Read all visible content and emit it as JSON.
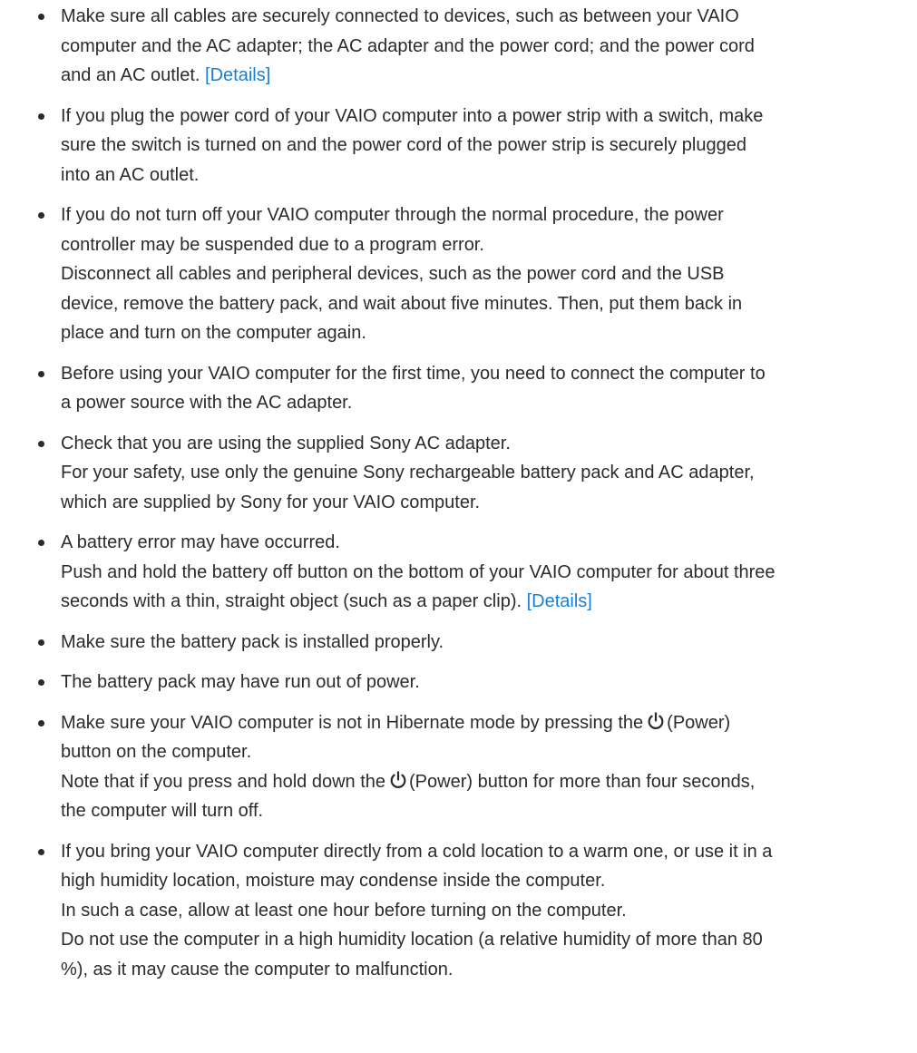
{
  "tips": [
    {
      "lines": [
        "Make sure all cables are securely connected to devices, such as between your VAIO",
        "computer and the AC adapter; the AC adapter and the power cord; and the power cord",
        "and an AC outlet."
      ],
      "link": "[Details]"
    },
    {
      "lines": [
        "If you plug the power cord of your VAIO computer into a power strip with a switch, make",
        "sure the switch is turned on and the power cord of the power strip is securely plugged",
        "into an AC outlet."
      ]
    },
    {
      "lines": [
        "If you do not turn off your VAIO computer through the normal procedure, the power",
        "controller may be suspended due to a program error.",
        "Disconnect all cables and peripheral devices, such as the power cord and the USB",
        "device, remove the battery pack, and wait about five minutes. Then, put them back in",
        "place and turn on the computer again."
      ]
    },
    {
      "lines": [
        "Before using your VAIO computer for the first time, you need to connect the computer to",
        "a power source with the AC adapter."
      ]
    },
    {
      "lines": [
        "Check that you are using the supplied Sony AC adapter.",
        "For your safety, use only the genuine Sony rechargeable battery pack and AC adapter,",
        "which are supplied by Sony for your VAIO computer."
      ]
    },
    {
      "lines": [
        "A battery error may have occurred.",
        "Push and hold the battery off button on the bottom of your VAIO computer for about three",
        "seconds with a thin, straight object (such as a paper clip)."
      ],
      "link": "[Details]"
    },
    {
      "lines": [
        "Make sure the battery pack is installed properly."
      ]
    },
    {
      "lines": [
        "The battery pack may have run out of power."
      ]
    },
    {
      "power_lines": {
        "a_before": "Make sure your VAIO computer is not in Hibernate mode by pressing the",
        "a_after": "(Power)",
        "b": "button on the computer.",
        "c_before": "Note that if you press and hold down the",
        "c_after": "(Power) button for more than four seconds,",
        "d": "the computer will turn off."
      },
      "icon": "power-icon"
    },
    {
      "lines": [
        "If you bring your VAIO computer directly from a cold location to a warm one, or use it in a",
        "high humidity location, moisture may condense inside the computer.",
        "In such a case, allow at least one hour before turning on the computer.",
        "Do not use the computer in a high humidity location (a relative humidity of more than 80",
        "%), as it may cause the computer to malfunction."
      ]
    }
  ]
}
